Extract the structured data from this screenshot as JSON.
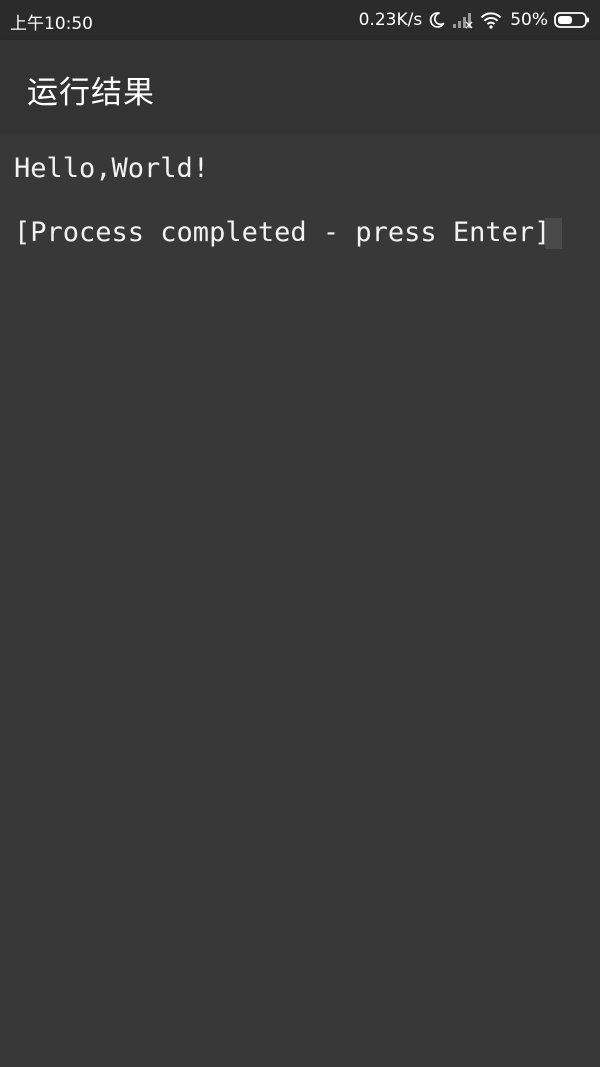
{
  "status_bar": {
    "time": "上午10:50",
    "network_speed": "0.23K/s",
    "battery_percent": "50%",
    "icons": [
      "moon-icon",
      "signal-icon",
      "wifi-icon",
      "battery-icon"
    ]
  },
  "app_bar": {
    "title": "运行结果"
  },
  "terminal": {
    "lines": [
      "Hello,World!",
      "[Process completed - press Enter]"
    ]
  },
  "colors": {
    "status_bar_bg": "#2b2b2b",
    "app_bar_bg": "#333333",
    "terminal_bg": "#383838",
    "text": "#f2f2f2"
  }
}
